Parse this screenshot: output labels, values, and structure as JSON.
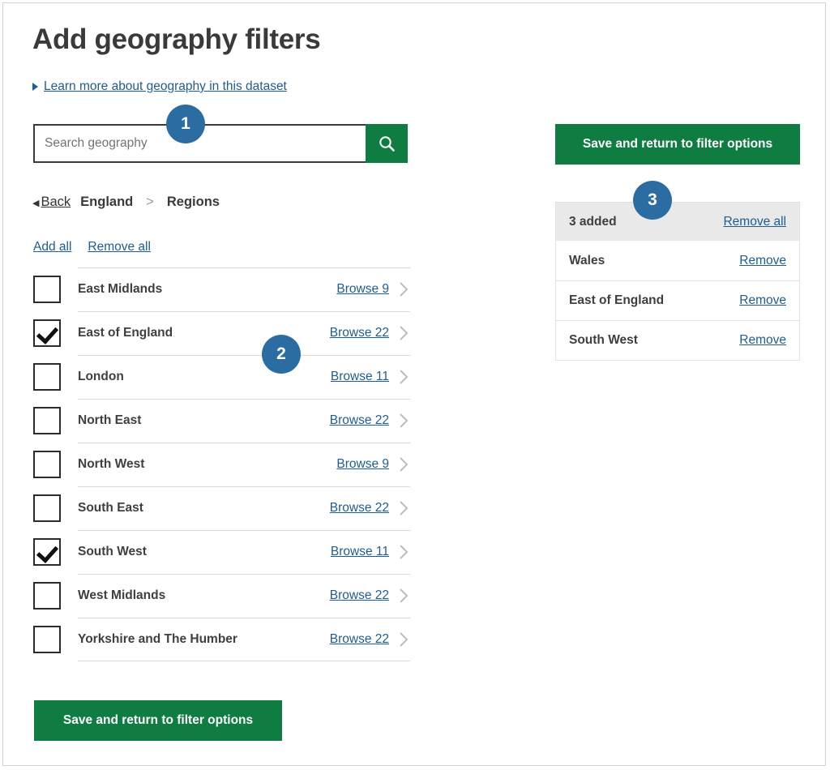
{
  "page": {
    "title": "Add geography filters",
    "learn_more_link": "Learn more about geography in this dataset"
  },
  "search": {
    "placeholder": "Search geography",
    "value": "",
    "button_icon": "search-icon"
  },
  "breadcrumb": {
    "back_label": "Back",
    "back_arrow": "◀",
    "parent": "England",
    "separator": ">",
    "current": "Regions"
  },
  "bulk_actions": {
    "add_all": "Add all",
    "remove_all": "Remove all"
  },
  "options": [
    {
      "label": "East Midlands",
      "browse": "Browse 9",
      "checked": false
    },
    {
      "label": "East of England",
      "browse": "Browse 22",
      "checked": true
    },
    {
      "label": "London",
      "browse": "Browse 11",
      "checked": false
    },
    {
      "label": "North East",
      "browse": "Browse 22",
      "checked": false
    },
    {
      "label": "North West",
      "browse": "Browse 9",
      "checked": false
    },
    {
      "label": "South East",
      "browse": "Browse 22",
      "checked": false
    },
    {
      "label": "South West",
      "browse": "Browse 11",
      "checked": true
    },
    {
      "label": "West Midlands",
      "browse": "Browse 22",
      "checked": false
    },
    {
      "label": "Yorkshire and The Humber",
      "browse": "Browse 22",
      "checked": false
    }
  ],
  "buttons": {
    "save_top": "Save and return to filter options",
    "save_bottom": "Save and return to filter options"
  },
  "added_panel": {
    "count_label": "3 added",
    "remove_all": "Remove all",
    "items": [
      {
        "name": "Wales",
        "remove": "Remove"
      },
      {
        "name": "East of England",
        "remove": "Remove"
      },
      {
        "name": "South West",
        "remove": "Remove"
      }
    ]
  },
  "callouts": [
    {
      "number": "1"
    },
    {
      "number": "2"
    },
    {
      "number": "3"
    }
  ],
  "colors": {
    "green": "#0f7c42",
    "link_blue": "#1d5d92",
    "badge_blue": "#2b6ca3",
    "panel_header_grey": "#e9e9e9"
  }
}
